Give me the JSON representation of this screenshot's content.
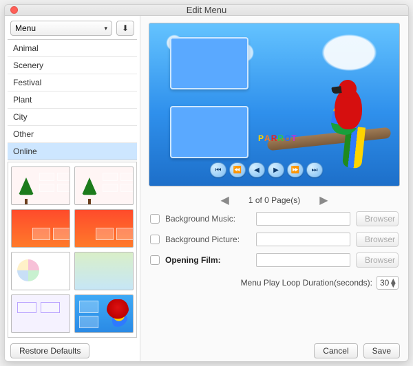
{
  "window": {
    "title": "Edit Menu"
  },
  "dropdown": {
    "label": "Menu"
  },
  "categories": {
    "items": [
      "Animal",
      "Scenery",
      "Festival",
      "Plant",
      "City",
      "Other",
      "Online"
    ],
    "selected_index": 6
  },
  "thumbnails": [
    {
      "kind": "tree"
    },
    {
      "kind": "tree"
    },
    {
      "kind": "flower"
    },
    {
      "kind": "flower"
    },
    {
      "kind": "collage"
    },
    {
      "kind": "kid"
    },
    {
      "kind": "modern"
    },
    {
      "kind": "parrot"
    }
  ],
  "preview": {
    "wordmark": {
      "letters": [
        "P",
        "A",
        "R",
        "R",
        "O",
        "T"
      ],
      "colors": [
        "#ffd400",
        "#ff7a1c",
        "#e62020",
        "#2ecc40",
        "#2a6df4",
        "#c92bd6"
      ]
    },
    "transport": [
      "⏮",
      "⏪",
      "◀",
      "▶",
      "⏩",
      "⏭"
    ]
  },
  "pager": {
    "text": "1 of 0 Page(s)"
  },
  "form": {
    "bgmusic": {
      "label": "Background Music:",
      "browser": "Browser"
    },
    "bgpic": {
      "label": "Background Picture:",
      "browser": "Browser"
    },
    "opening": {
      "label": "Opening Film:",
      "browser": "Browser"
    },
    "loop": {
      "label": "Menu Play Loop Duration(seconds):",
      "value": "30"
    }
  },
  "buttons": {
    "restore": "Restore Defaults",
    "cancel": "Cancel",
    "save": "Save"
  },
  "icons": {
    "download": "⬇"
  }
}
